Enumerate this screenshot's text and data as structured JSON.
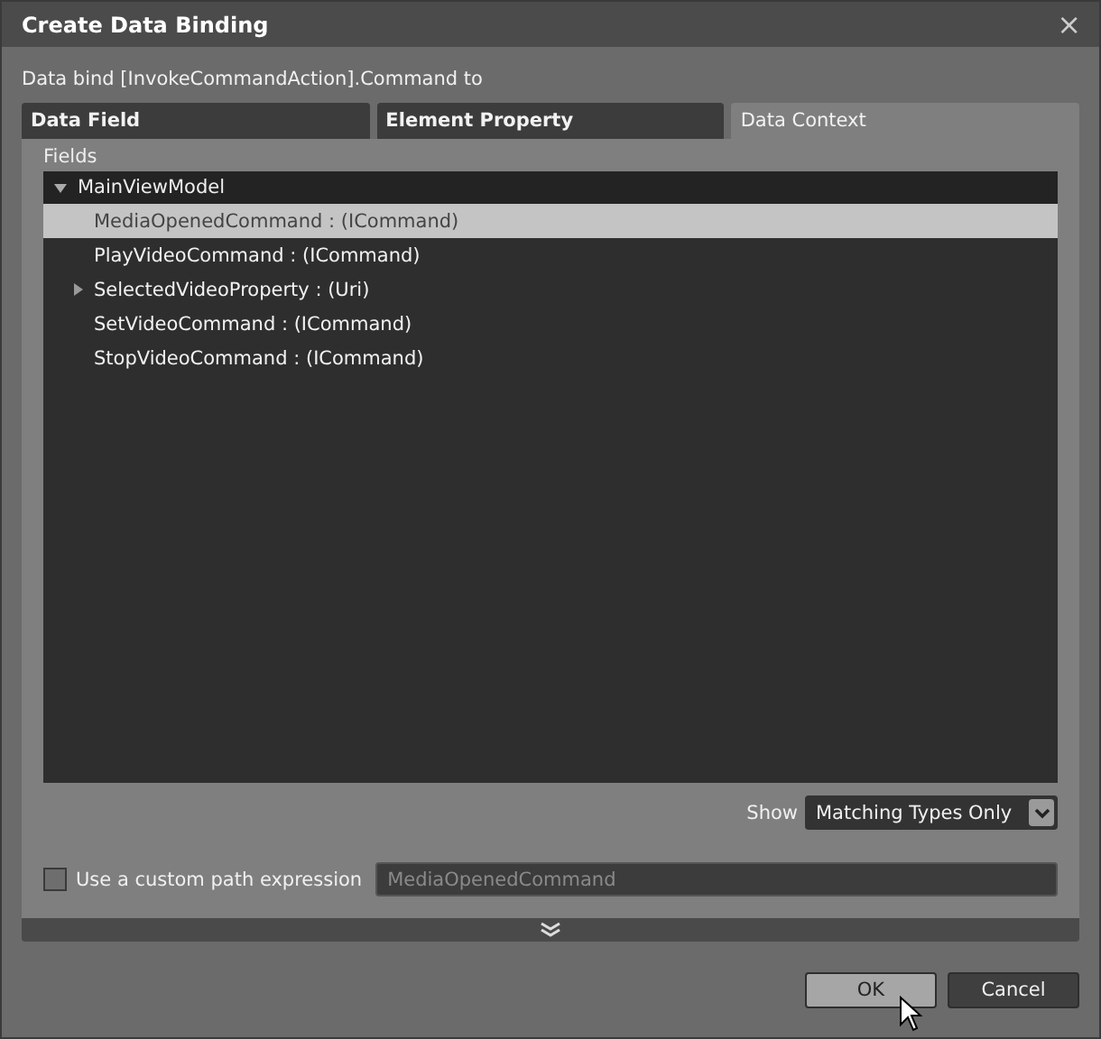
{
  "window": {
    "title": "Create Data Binding",
    "close": "×"
  },
  "subtitle": "Data bind [InvokeCommandAction].Command to",
  "tabs": [
    {
      "label": "Data Field",
      "selected": false
    },
    {
      "label": "Element Property",
      "selected": false
    },
    {
      "label": "Data Context",
      "selected": true
    }
  ],
  "fields_label": "Fields",
  "tree": {
    "label": "MainViewModel",
    "expanded": true,
    "children": [
      {
        "label": "MediaOpenedCommand : (ICommand)",
        "selected": true
      },
      {
        "label": "PlayVideoCommand : (ICommand)",
        "selected": false
      },
      {
        "label": "SelectedVideoProperty : (Uri)",
        "selected": false,
        "expanded": false
      },
      {
        "label": "SetVideoCommand : (ICommand)",
        "selected": false
      },
      {
        "label": "StopVideoCommand : (ICommand)",
        "selected": false
      }
    ]
  },
  "show": {
    "label": "Show",
    "value": "Matching Types Only"
  },
  "custom_path": {
    "label": "Use a custom path expression",
    "checked": false,
    "value": "MediaOpenedCommand",
    "disabled": true
  },
  "buttons": [
    {
      "label": "OK",
      "selected": true
    },
    {
      "label": "Cancel",
      "selected": false
    }
  ]
}
